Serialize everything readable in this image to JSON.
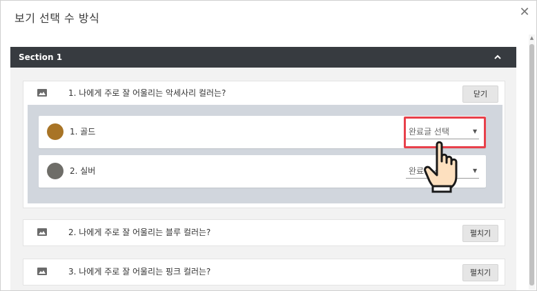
{
  "dialog": {
    "title": "보기 선택 수 방식",
    "close_icon": "close-icon"
  },
  "section": {
    "label": "Section 1",
    "toggle_icon": "chevron-up-icon"
  },
  "questions": [
    {
      "text": "1. 나에게 주로 잘 어울리는 악세사리 컬러는?",
      "button": "닫기",
      "options": [
        {
          "label": "1. 골드",
          "color": "#a87426",
          "select_value": "완료글 선택"
        },
        {
          "label": "2. 실버",
          "color": "#6e6d68",
          "select_value": "완료글 선택"
        }
      ]
    },
    {
      "text": "2. 나에게 주로 잘 어울리는 블루 컬러는?",
      "button": "펼치기"
    },
    {
      "text": "3. 나에게 주로 잘 어울리는 핑크 컬러는?",
      "button": "펼치기"
    }
  ],
  "icons": {
    "question_image": "image-icon",
    "cursor": "hand-pointer-icon"
  },
  "colors": {
    "section_header": "#373b40",
    "highlight": "#e8404a",
    "options_background": "#d1d6dd"
  }
}
